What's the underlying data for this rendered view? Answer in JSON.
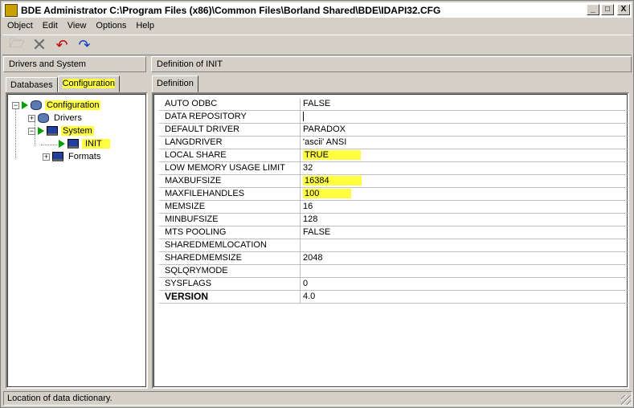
{
  "window": {
    "title": "BDE Administrator  C:\\Program Files (x86)\\Common Files\\Borland Shared\\BDE\\IDAPI32.CFG",
    "minimize": "_",
    "maximize": "□",
    "close": "X"
  },
  "menu": [
    "Object",
    "Edit",
    "View",
    "Options",
    "Help"
  ],
  "left": {
    "header": "Drivers and System",
    "tabs": [
      "Databases",
      "Configuration"
    ],
    "tree": [
      "Configuration",
      "Drivers",
      "System",
      "INIT",
      "Formats"
    ]
  },
  "right": {
    "header": "Definition of INIT",
    "tab": "Definition",
    "rows": [
      {
        "name": "AUTO ODBC",
        "value": "FALSE"
      },
      {
        "name": "DATA REPOSITORY",
        "value": ""
      },
      {
        "name": "DEFAULT DRIVER",
        "value": "PARADOX"
      },
      {
        "name": "LANGDRIVER",
        "value": "'ascii' ANSI"
      },
      {
        "name": "LOCAL SHARE",
        "value": "TRUE"
      },
      {
        "name": "LOW MEMORY USAGE LIMIT",
        "value": "32"
      },
      {
        "name": "MAXBUFSIZE",
        "value": "16384"
      },
      {
        "name": "MAXFILEHANDLES",
        "value": "100"
      },
      {
        "name": "MEMSIZE",
        "value": "16"
      },
      {
        "name": "MINBUFSIZE",
        "value": "128"
      },
      {
        "name": "MTS POOLING",
        "value": "FALSE"
      },
      {
        "name": "SHAREDMEMLOCATION",
        "value": ""
      },
      {
        "name": "SHAREDMEMSIZE",
        "value": "2048"
      },
      {
        "name": "SQLQRYMODE",
        "value": ""
      },
      {
        "name": "SYSFLAGS",
        "value": "0"
      },
      {
        "name": "VERSION",
        "value": "4.0"
      }
    ]
  },
  "status": "Location of data dictionary.",
  "colors": {
    "highlight": "#ffff40",
    "tree_arrow": "#00a000"
  }
}
